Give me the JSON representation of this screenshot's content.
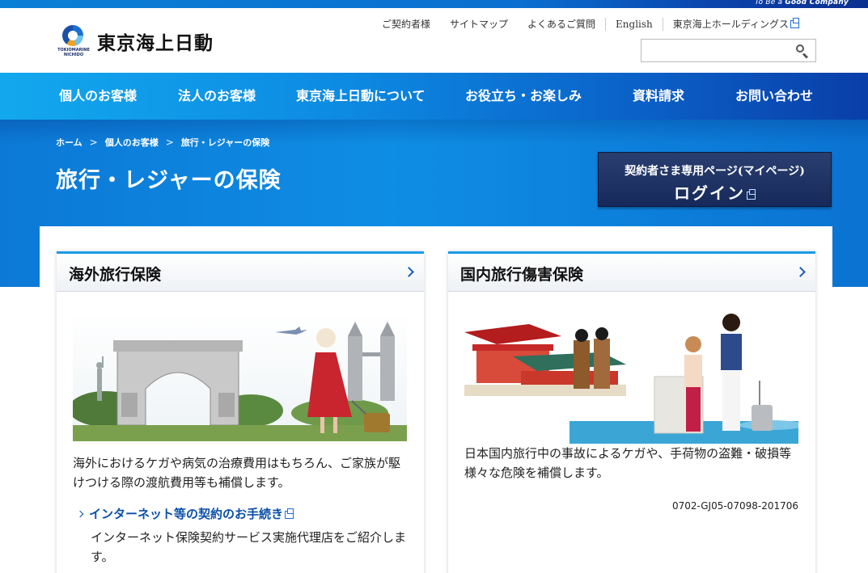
{
  "brand": {
    "tagline_prefix": "To Be a",
    "tagline_bold": "Good Company",
    "logo_sub_line1": "TOKIOMARINE",
    "logo_sub_line2": "NICHIDO",
    "logo_text": "東京海上日動"
  },
  "utility_nav": [
    {
      "label": "ご契約者様"
    },
    {
      "label": "サイトマップ"
    },
    {
      "label": "よくあるご質問"
    },
    {
      "label": "English"
    },
    {
      "label": "東京海上ホールディングス"
    }
  ],
  "search": {
    "value": "",
    "placeholder": ""
  },
  "global_nav": [
    {
      "label": "個人のお客様"
    },
    {
      "label": "法人のお客様"
    },
    {
      "label": "東京海上日動について"
    },
    {
      "label": "お役立ち・お楽しみ"
    },
    {
      "label": "資料請求"
    },
    {
      "label": "お問い合わせ"
    }
  ],
  "breadcrumb": [
    {
      "label": "ホーム"
    },
    {
      "label": "個人のお客様"
    },
    {
      "label": "旅行・レジャーの保険"
    }
  ],
  "page_title": "旅行・レジャーの保険",
  "mypage": {
    "line1": "契約者さま専用ページ(マイページ)",
    "line2": "ログイン"
  },
  "cards": [
    {
      "title": "海外旅行保険",
      "description": "海外におけるケガや病気の治療費用はもちろん、ご家族が駆けつける際の渡航費用等も補償します。",
      "link": "インターネット等の契約のお手続き",
      "link_sub": "インターネット保険契約サービス実施代理店をご紹介します。"
    },
    {
      "title": "国内旅行傷害保険",
      "description": "日本国内旅行中の事故によるケガや、手荷物の盗難・破損等様々な危険を補償します。",
      "code": "0702-GJ05-07098-201706"
    }
  ]
}
